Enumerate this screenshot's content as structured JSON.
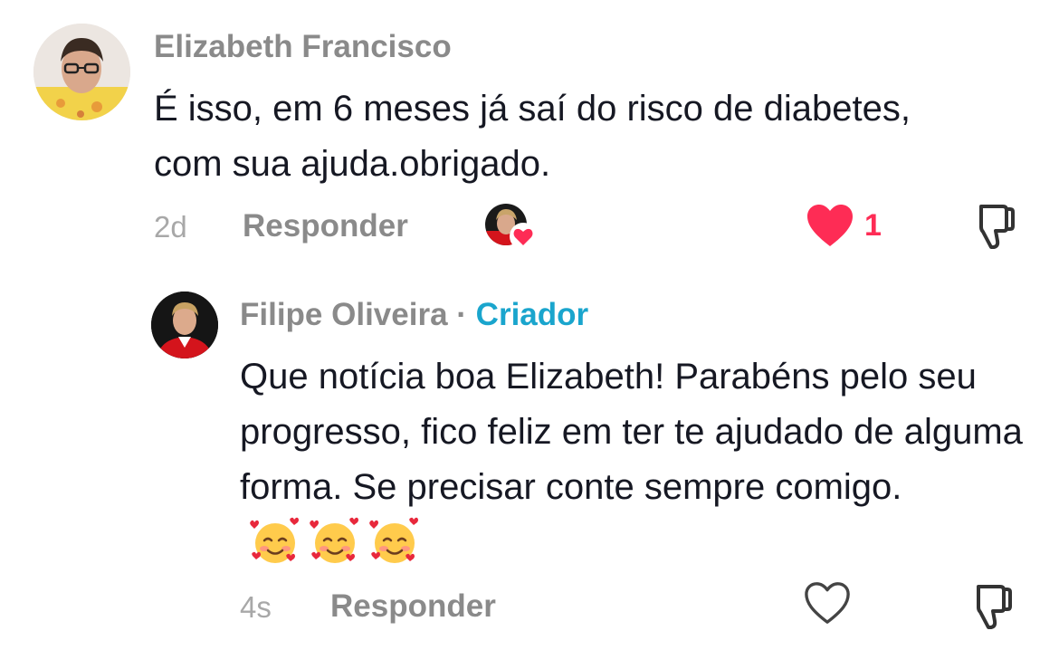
{
  "comment": {
    "author": "Elizabeth Francisco",
    "text": "É isso, em 6 meses já saí do risco de diabetes, com sua ajuda.obrigado.",
    "time": "2d",
    "reply_label": "Responder",
    "like_count": "1",
    "liked": true,
    "liked_by_creator": true
  },
  "reply": {
    "author": "Filipe Oliveira",
    "separator": "·",
    "badge": "Criador",
    "text": "Que notícia boa Elizabeth! Parabéns pelo seu progresso, fico feliz em ter te ajudado de alguma forma. Se precisar conte sempre comigo.",
    "emoji_icons": [
      "smiling-face-with-hearts",
      "smiling-face-with-hearts",
      "smiling-face-with-hearts"
    ],
    "time": "4s",
    "reply_label": "Responder",
    "liked": false
  },
  "colors": {
    "like_red": "#fe2c55",
    "creator_blue": "#1aa5cd",
    "muted_text": "#8a8a8a"
  }
}
